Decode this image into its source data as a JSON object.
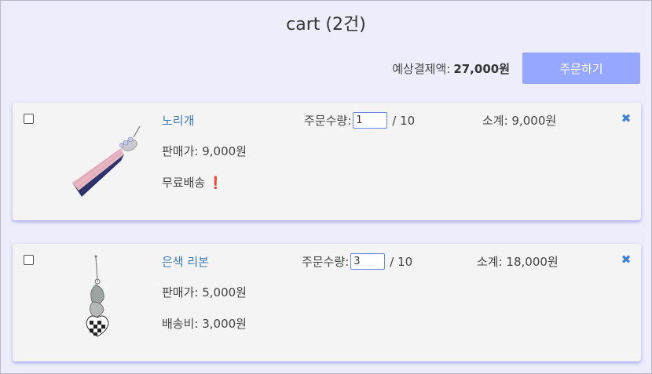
{
  "header": {
    "title": "cart (2건)"
  },
  "summary": {
    "total_label": "예상결제액:",
    "total_value": "27,000원",
    "order_button": "주문하기"
  },
  "items": [
    {
      "name": "노리개",
      "qty_label": "주문수량:",
      "qty_value": "1",
      "qty_max": "/ 10",
      "subtotal": "소계: 9,000원",
      "price": "판매가: 9,000원",
      "shipping": "무료배송",
      "shipping_warning": "❗",
      "thumbnail": "norigae-tassel-image"
    },
    {
      "name": "은색 리본",
      "qty_label": "주문수량:",
      "qty_value": "3",
      "qty_max": "/ 10",
      "subtotal": "소계: 18,000원",
      "price": "판매가: 5,000원",
      "shipping": "배송비: 3,000원",
      "thumbnail": "silver-ribbon-charm-image"
    }
  ],
  "icons": {
    "remove": "close-x-icon",
    "select": "checkbox"
  },
  "colors": {
    "background": "#ededfb",
    "card": "#f4f4f4",
    "order_button": "#95a7ff",
    "link": "#3d7ab8",
    "remove_icon": "#3b7fd0",
    "warning": "#e0262b"
  }
}
